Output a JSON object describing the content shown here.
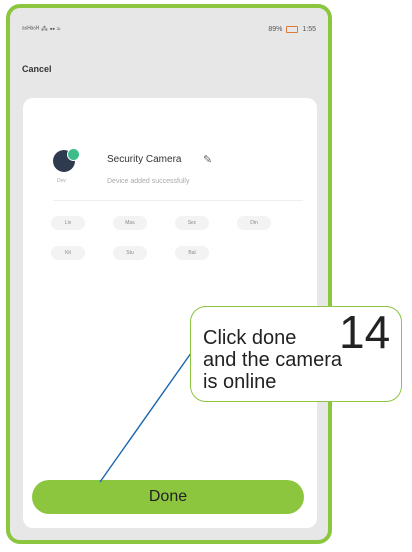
{
  "status_bar": {
    "left_text": "ᵃ⁶ᴴᵃ⁶ᴴ ⁂ ▪▪ ≈",
    "right_text": "89%",
    "time": "1:55"
  },
  "nav": {
    "cancel_label": "Cancel"
  },
  "device": {
    "name": "Security Camera",
    "subtitle": "Device added successfully",
    "avatar_badge": "Dev"
  },
  "room_chips": [
    "Liv",
    "Mas",
    "Sec",
    "Din",
    "Kit",
    "Stu",
    "Bal"
  ],
  "done_label": "Done",
  "callout": {
    "text_line1": "Click done",
    "text_line2": "and the camera",
    "text_line3": "is online",
    "step_number": "14"
  },
  "colors": {
    "accent": "#8cc63f",
    "device_online_dot": "#3dbd8a",
    "background": "#e7e7e7"
  },
  "icons": [
    "edit-pencil-icon",
    "battery-icon",
    "camera-device-icon"
  ]
}
